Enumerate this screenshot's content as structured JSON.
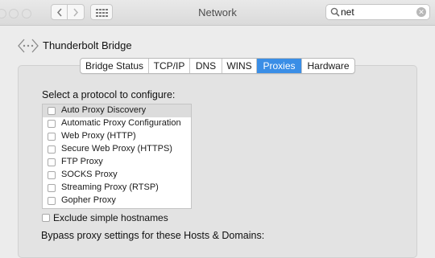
{
  "window": {
    "title": "Network"
  },
  "search": {
    "value": "net",
    "clear_glyph": "✕"
  },
  "service": {
    "name": "Thunderbolt Bridge",
    "icon": "thunderbolt-bridge-icon"
  },
  "tabs": [
    {
      "label": "Bridge Status",
      "active": false
    },
    {
      "label": "TCP/IP",
      "active": false
    },
    {
      "label": "DNS",
      "active": false
    },
    {
      "label": "WINS",
      "active": false
    },
    {
      "label": "Proxies",
      "active": true
    },
    {
      "label": "Hardware",
      "active": false
    }
  ],
  "proxies": {
    "prompt": "Select a protocol to configure:",
    "protocols": [
      {
        "label": "Auto Proxy Discovery",
        "checked": false,
        "selected": true
      },
      {
        "label": "Automatic Proxy Configuration",
        "checked": false,
        "selected": false
      },
      {
        "label": "Web Proxy (HTTP)",
        "checked": false,
        "selected": false
      },
      {
        "label": "Secure Web Proxy (HTTPS)",
        "checked": false,
        "selected": false
      },
      {
        "label": "FTP Proxy",
        "checked": false,
        "selected": false
      },
      {
        "label": "SOCKS Proxy",
        "checked": false,
        "selected": false
      },
      {
        "label": "Streaming Proxy (RTSP)",
        "checked": false,
        "selected": false
      },
      {
        "label": "Gopher Proxy",
        "checked": false,
        "selected": false
      }
    ],
    "exclude_simple_hostnames": {
      "label": "Exclude simple hostnames",
      "checked": false
    },
    "bypass_label": "Bypass proxy settings for these Hosts & Domains:"
  },
  "colors": {
    "accent": "#3a8ee6",
    "selected_row": "#dcdcdc",
    "window_bg": "#ececec"
  }
}
